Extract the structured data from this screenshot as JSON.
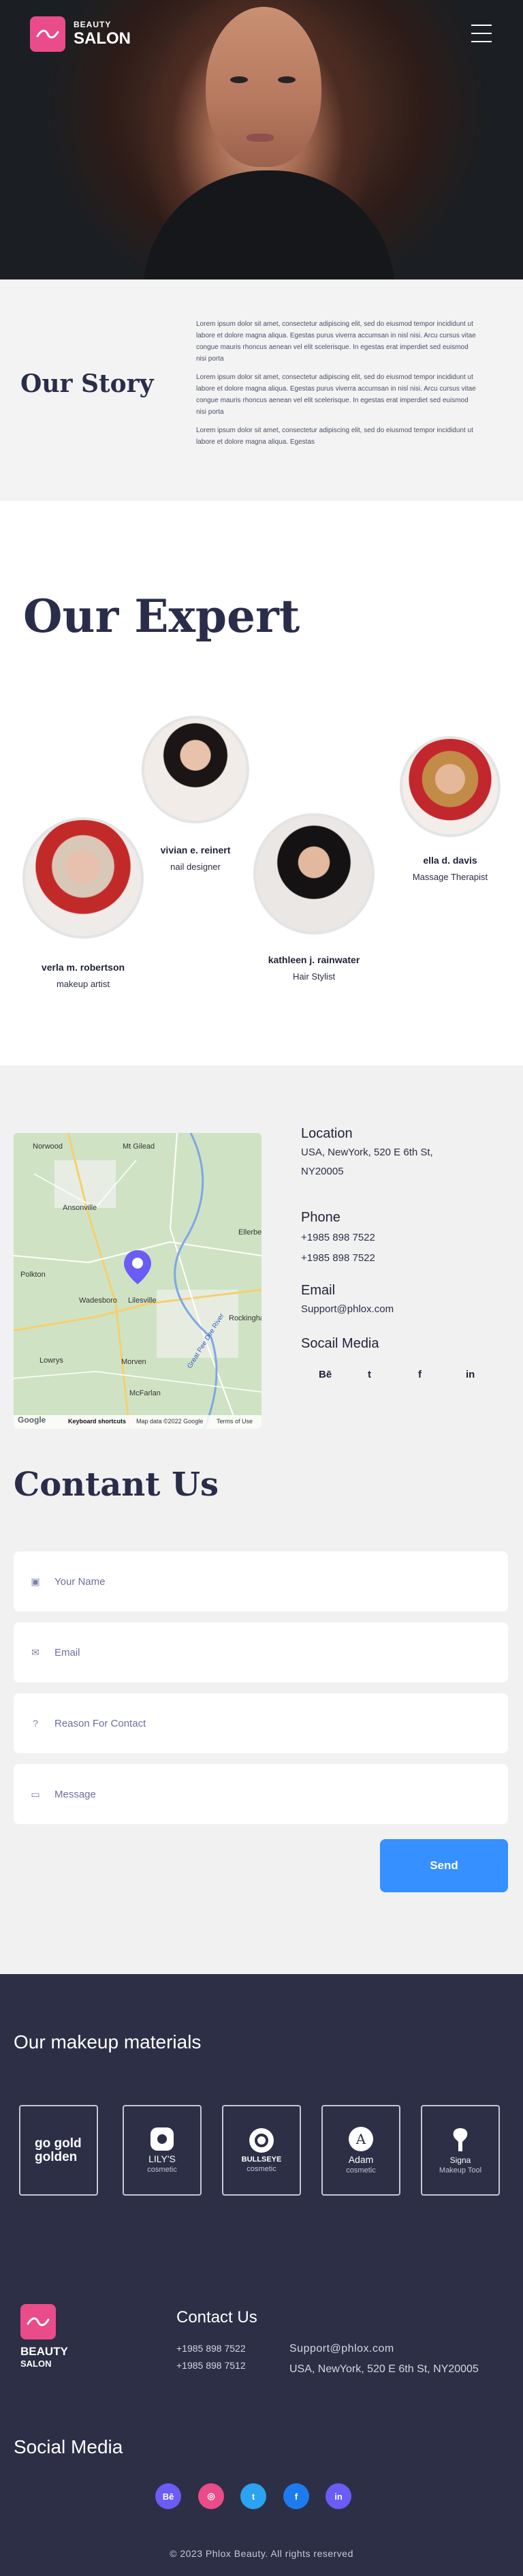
{
  "header": {
    "logo_top": "BEAUTY",
    "logo_bottom": "SALON"
  },
  "story": {
    "title": "Our Story",
    "paragraphs": [
      "Lorem ipsum dolor sit amet, consectetur adipiscing elit, sed do eiusmod tempor incididunt ut labore et dolore magna aliqua. Egestas purus viverra accumsan in nisl nisi. Arcu cursus vitae congue mauris rhoncus aenean vel elit scelerisque. In egestas erat imperdiet sed euismod nisi porta",
      "Lorem ipsum dolor sit amet, consectetur adipiscing elit, sed do eiusmod tempor incididunt ut labore et dolore magna aliqua. Egestas purus viverra accumsan in nisl nisi. Arcu cursus vitae congue mauris rhoncus aenean vel elit scelerisque. In egestas erat imperdiet sed euismod nisi porta",
      "Lorem ipsum dolor sit amet, consectetur adipiscing elit, sed do eiusmod tempor incididunt ut labore et dolore magna aliqua. Egestas"
    ]
  },
  "experts": {
    "title": "Our Expert",
    "people": [
      {
        "name": "vivian e. reinert",
        "role": "nail designer"
      },
      {
        "name": "ella d. davis",
        "role": "Massage Therapist"
      },
      {
        "name": "verla m. robertson",
        "role": "makeup artist"
      },
      {
        "name": "kathleen j. rainwater",
        "role": "Hair Stylist"
      }
    ]
  },
  "map": {
    "places": [
      "Lilesville",
      "Ansonville",
      "Polkton",
      "Wadesboro",
      "Norwood",
      "Mt Gilead",
      "Ellerbe",
      "Rockingham",
      "Morven",
      "McFarlan",
      "Lowrys",
      "Great Pee Dee River"
    ],
    "google_label": "Google",
    "footer": [
      "Keyboard shortcuts",
      "Map data ©2022 Google",
      "Terms of Use"
    ]
  },
  "contact_info": {
    "location_label": "Location",
    "location_lines": [
      "USA, NewYork, 520 E 6th St,",
      "NY20005"
    ],
    "phone_label": "Phone",
    "phones": [
      "+1985 898 7522",
      "+1985 898 7522"
    ],
    "email_label": "Email",
    "email": "Support@phlox.com",
    "social_label": "Socail Media",
    "socials": [
      "Bē",
      "t",
      "f",
      "in"
    ]
  },
  "form": {
    "title": "Contant Us",
    "name_placeholder": "Your Name",
    "email_placeholder": "Email",
    "reason_placeholder": "Reason For Contact",
    "message_placeholder": "Message",
    "send_label": "Send"
  },
  "materials": {
    "title": "Our makeup materials",
    "brands": [
      {
        "name": "go gold golden",
        "sub": ""
      },
      {
        "name": "LILY'S",
        "sub": "cosmetic"
      },
      {
        "name": "BULLSEYE",
        "sub": "cosmetic"
      },
      {
        "name": "Adam",
        "sub": "cosmetic"
      },
      {
        "name": "Signa",
        "sub": "Makeup Tool"
      }
    ]
  },
  "footer": {
    "logo_top": "BEAUTY",
    "logo_bottom": "SALON",
    "contact_title": "Contact Us",
    "phones": [
      "+1985 898 7522",
      "+1985 898 7512"
    ],
    "email": "Support@phlox.com",
    "address": "USA, NewYork, 520 E 6th St, NY20005",
    "social_title": "Social Media",
    "socials": [
      {
        "label": "Bē",
        "color": "#6a5cf5"
      },
      {
        "label": "◎",
        "color": "#ea4c89"
      },
      {
        "label": "t",
        "color": "#2aa3f0"
      },
      {
        "label": "f",
        "color": "#1d7bf0"
      },
      {
        "label": "in",
        "color": "#6a5cf5"
      }
    ],
    "copyright": "© 2023 Phlox Beauty. All rights reserved"
  },
  "colors": {
    "accent_pink": "#ea4c89",
    "accent_blue": "#3690ff",
    "dark_bg": "#2c2f46"
  }
}
